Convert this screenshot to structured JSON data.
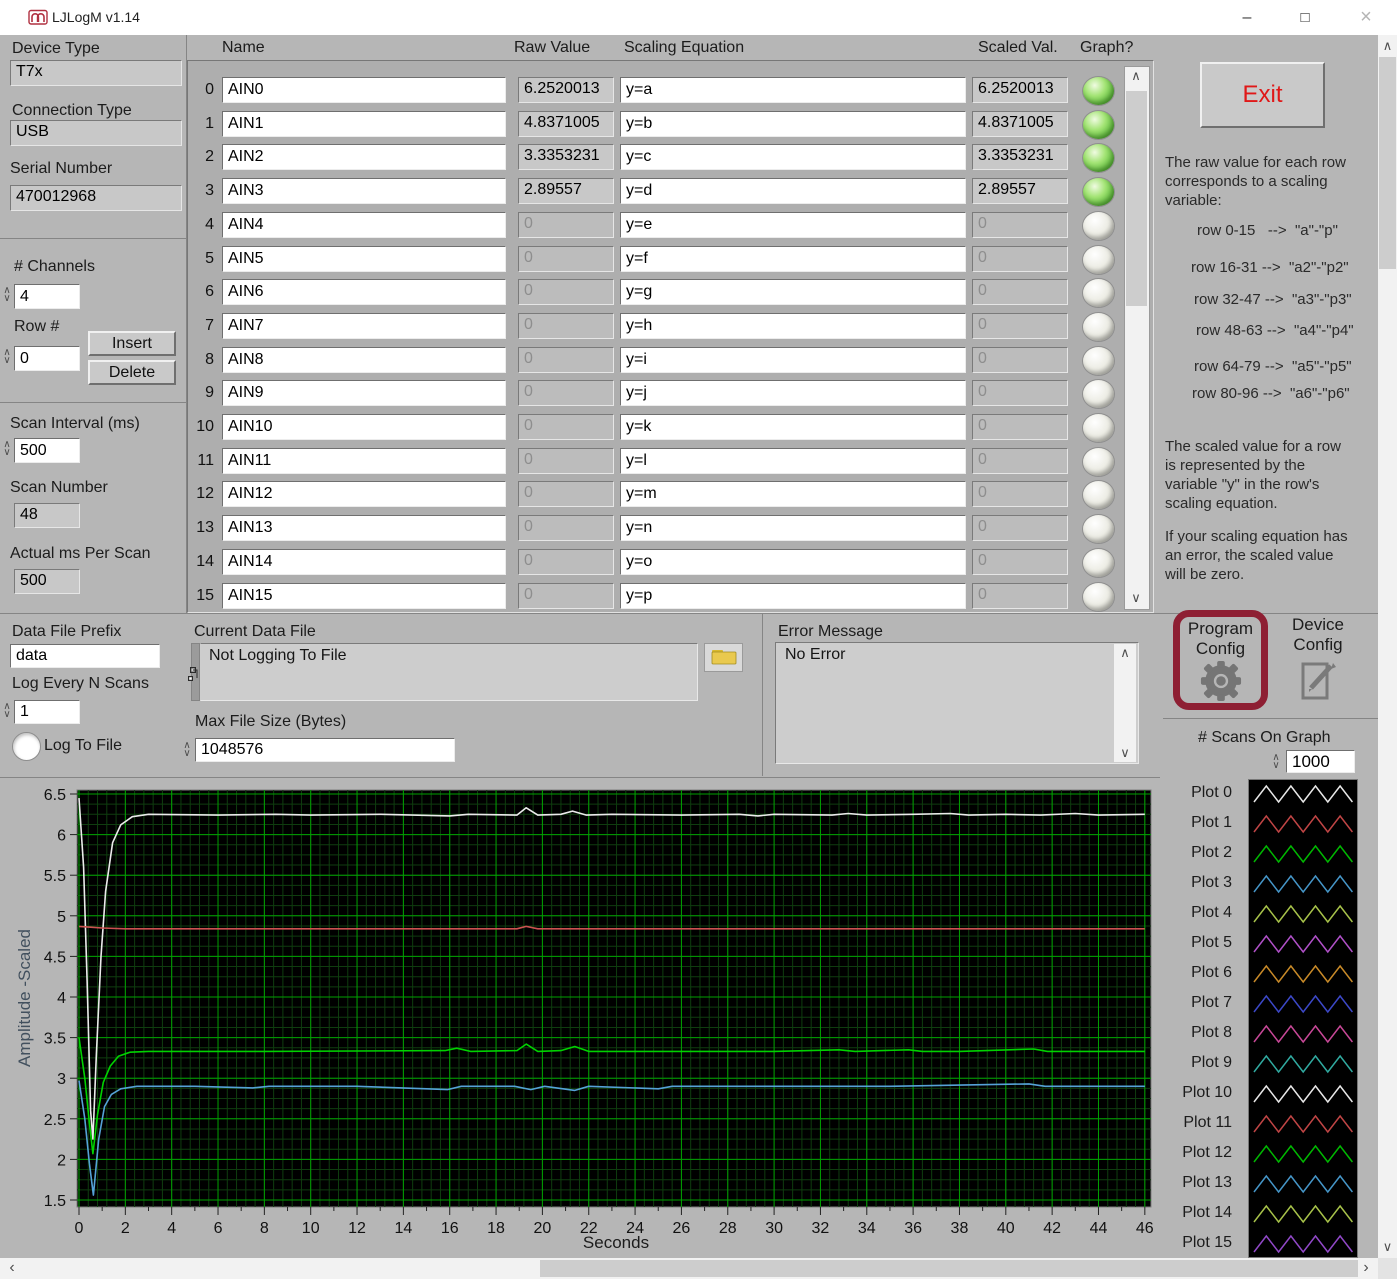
{
  "title_bar": {
    "title": "LJLogM v1.14",
    "minimize": "–",
    "maximize": "□",
    "close": "×"
  },
  "left_panel": {
    "device_type_label": "Device Type",
    "device_type": "T7x",
    "connection_type_label": "Connection Type",
    "connection_type": "USB",
    "serial_number_label": "Serial Number",
    "serial_number": "470012968",
    "channels_label": "# Channels",
    "channels": "4",
    "row_label": "Row #",
    "row": "0",
    "insert_label": "Insert",
    "delete_label": "Delete",
    "scan_interval_label": "Scan Interval (ms)",
    "scan_interval": "500",
    "scan_number_label": "Scan Number",
    "scan_number": "48",
    "actual_ms_label": "Actual ms Per Scan",
    "actual_ms": "500"
  },
  "table": {
    "headers": {
      "name": "Name",
      "raw": "Raw Value",
      "equation": "Scaling Equation",
      "scaled": "Scaled Val.",
      "graph": "Graph?"
    },
    "rows": [
      {
        "index": "0",
        "name": "AIN0",
        "raw": "6.2520013",
        "equation": "y=a",
        "scaled": "6.2520013",
        "graph_on": true
      },
      {
        "index": "1",
        "name": "AIN1",
        "raw": "4.8371005",
        "equation": "y=b",
        "scaled": "4.8371005",
        "graph_on": true
      },
      {
        "index": "2",
        "name": "AIN2",
        "raw": "3.3353231",
        "equation": "y=c",
        "scaled": "3.3353231",
        "graph_on": true
      },
      {
        "index": "3",
        "name": "AIN3",
        "raw": "2.89557",
        "equation": "y=d",
        "scaled": "2.89557",
        "graph_on": true
      },
      {
        "index": "4",
        "name": "AIN4",
        "raw": "0",
        "equation": "y=e",
        "scaled": "0",
        "graph_on": false
      },
      {
        "index": "5",
        "name": "AIN5",
        "raw": "0",
        "equation": "y=f",
        "scaled": "0",
        "graph_on": false
      },
      {
        "index": "6",
        "name": "AIN6",
        "raw": "0",
        "equation": "y=g",
        "scaled": "0",
        "graph_on": false
      },
      {
        "index": "7",
        "name": "AIN7",
        "raw": "0",
        "equation": "y=h",
        "scaled": "0",
        "graph_on": false
      },
      {
        "index": "8",
        "name": "AIN8",
        "raw": "0",
        "equation": "y=i",
        "scaled": "0",
        "graph_on": false
      },
      {
        "index": "9",
        "name": "AIN9",
        "raw": "0",
        "equation": "y=j",
        "scaled": "0",
        "graph_on": false
      },
      {
        "index": "10",
        "name": "AIN10",
        "raw": "0",
        "equation": "y=k",
        "scaled": "0",
        "graph_on": false
      },
      {
        "index": "11",
        "name": "AIN11",
        "raw": "0",
        "equation": "y=l",
        "scaled": "0",
        "graph_on": false
      },
      {
        "index": "12",
        "name": "AIN12",
        "raw": "0",
        "equation": "y=m",
        "scaled": "0",
        "graph_on": false
      },
      {
        "index": "13",
        "name": "AIN13",
        "raw": "0",
        "equation": "y=n",
        "scaled": "0",
        "graph_on": false
      },
      {
        "index": "14",
        "name": "AIN14",
        "raw": "0",
        "equation": "y=o",
        "scaled": "0",
        "graph_on": false
      },
      {
        "index": "15",
        "name": "AIN15",
        "raw": "0",
        "equation": "y=p",
        "scaled": "0",
        "graph_on": false
      }
    ]
  },
  "right_panel": {
    "exit_label": "Exit",
    "info1": "The raw value for each row\ncorresponds to a scaling\nvariable:",
    "mappings": [
      "row 0-15   -->  \"a\"-\"p\"",
      "row 16-31 -->  \"a2\"-\"p2\"",
      "row 32-47 -->  \"a3\"-\"p3\"",
      "row 48-63 -->  \"a4\"-\"p4\"",
      "row 64-79 -->  \"a5\"-\"p5\"",
      "row 80-96 -->  \"a6\"-\"p6\""
    ],
    "info2": "The scaled value for a row\nis represented by the\nvariable  \"y\" in the row's\nscaling equation.",
    "info3": "If your scaling  equation has\nan error, the scaled value\nwill be zero.",
    "program_config_label": "Program\nConfig",
    "device_config_label": "Device\nConfig",
    "scans_on_graph_label": "# Scans On Graph",
    "scans_on_graph": "1000"
  },
  "logging": {
    "data_file_prefix_label": "Data File Prefix",
    "data_file_prefix": "data",
    "log_every_label": "Log Every N Scans",
    "log_every": "1",
    "log_to_file_label": "Log To File",
    "current_data_file_label": "Current Data File",
    "current_data_file": "Not Logging To File",
    "max_file_size_label": "Max File Size (Bytes)",
    "max_file_size": "1048576"
  },
  "error_panel": {
    "label": "Error Message",
    "message": "No Error"
  },
  "colors": {
    "exit_text": "#e01818",
    "program_config_border": "#8e1f33",
    "led_on": "#5fbc3c",
    "led_off": "#e2e2da",
    "folder": "#e9c94e"
  },
  "chart_data": {
    "type": "line",
    "title": "",
    "xlabel": "Seconds",
    "ylabel": "Amplitude -Scaled",
    "xlim": [
      0,
      46
    ],
    "xtick_step": 2,
    "ylim": [
      1.5,
      6.5
    ],
    "ytick_step": 0.5,
    "x_minor": 0.4,
    "y_minor": 0.125,
    "grid": "on",
    "bg": "#000000",
    "major_grid": "#00a000",
    "minor_grid": "#0f3d0f",
    "series": [
      {
        "name": "AIN0 (Plot 0)",
        "color": "#ebebeb",
        "points": [
          [
            0,
            6.45
          ],
          [
            0.2,
            5.6
          ],
          [
            0.35,
            4.2
          ],
          [
            0.5,
            2.6
          ],
          [
            0.6,
            2.25
          ],
          [
            0.75,
            3.3
          ],
          [
            0.95,
            4.5
          ],
          [
            1.15,
            5.3
          ],
          [
            1.45,
            5.9
          ],
          [
            1.8,
            6.12
          ],
          [
            2.3,
            6.22
          ],
          [
            3,
            6.25
          ],
          [
            6,
            6.24
          ],
          [
            8.5,
            6.25
          ],
          [
            10,
            6.24
          ],
          [
            13,
            6.25
          ],
          [
            16,
            6.23
          ],
          [
            16.8,
            6.25
          ],
          [
            18.9,
            6.24
          ],
          [
            19.3,
            6.33
          ],
          [
            19.8,
            6.24
          ],
          [
            20.8,
            6.25
          ],
          [
            21.3,
            6.29
          ],
          [
            21.9,
            6.24
          ],
          [
            23,
            6.25
          ],
          [
            26,
            6.24
          ],
          [
            28.5,
            6.25
          ],
          [
            29.3,
            6.23
          ],
          [
            30,
            6.25
          ],
          [
            32.5,
            6.24
          ],
          [
            33.2,
            6.26
          ],
          [
            34,
            6.24
          ],
          [
            36,
            6.25
          ],
          [
            37.6,
            6.26
          ],
          [
            38.4,
            6.24
          ],
          [
            40,
            6.25
          ],
          [
            41.5,
            6.24
          ],
          [
            43,
            6.26
          ],
          [
            44,
            6.24
          ],
          [
            46,
            6.25
          ]
        ]
      },
      {
        "name": "AIN1 (Plot 1)",
        "color": "#cc5252",
        "points": [
          [
            0,
            4.87
          ],
          [
            0.5,
            4.86
          ],
          [
            1,
            4.85
          ],
          [
            2,
            4.84
          ],
          [
            6,
            4.84
          ],
          [
            18.9,
            4.84
          ],
          [
            19.3,
            4.87
          ],
          [
            19.8,
            4.84
          ],
          [
            30,
            4.84
          ],
          [
            46,
            4.84
          ]
        ]
      },
      {
        "name": "AIN2 (Plot 2)",
        "color": "#00d200",
        "points": [
          [
            0,
            3.5
          ],
          [
            0.25,
            3.0
          ],
          [
            0.45,
            2.45
          ],
          [
            0.6,
            2.07
          ],
          [
            0.8,
            2.55
          ],
          [
            1.05,
            2.95
          ],
          [
            1.35,
            3.15
          ],
          [
            1.7,
            3.27
          ],
          [
            2.2,
            3.32
          ],
          [
            3,
            3.33
          ],
          [
            8,
            3.33
          ],
          [
            15.8,
            3.34
          ],
          [
            16.3,
            3.37
          ],
          [
            16.9,
            3.33
          ],
          [
            18.9,
            3.34
          ],
          [
            19.3,
            3.42
          ],
          [
            19.8,
            3.33
          ],
          [
            20.8,
            3.34
          ],
          [
            21.4,
            3.39
          ],
          [
            22,
            3.33
          ],
          [
            25,
            3.33
          ],
          [
            30,
            3.33
          ],
          [
            32.8,
            3.35
          ],
          [
            33.5,
            3.33
          ],
          [
            35.8,
            3.35
          ],
          [
            36.4,
            3.33
          ],
          [
            38,
            3.33
          ],
          [
            41.2,
            3.36
          ],
          [
            41.8,
            3.33
          ],
          [
            44,
            3.33
          ],
          [
            46,
            3.33
          ]
        ]
      },
      {
        "name": "AIN3 (Plot 3)",
        "color": "#55a2d7",
        "points": [
          [
            0,
            2.97
          ],
          [
            0.25,
            2.5
          ],
          [
            0.45,
            1.95
          ],
          [
            0.62,
            1.56
          ],
          [
            0.85,
            2.25
          ],
          [
            1.1,
            2.65
          ],
          [
            1.4,
            2.8
          ],
          [
            1.8,
            2.87
          ],
          [
            2.5,
            2.9
          ],
          [
            5,
            2.9
          ],
          [
            7.5,
            2.88
          ],
          [
            8.2,
            2.9
          ],
          [
            12,
            2.9
          ],
          [
            15.9,
            2.86
          ],
          [
            16.5,
            2.9
          ],
          [
            18.8,
            2.9
          ],
          [
            19.5,
            2.86
          ],
          [
            20.1,
            2.9
          ],
          [
            21.4,
            2.85
          ],
          [
            22,
            2.9
          ],
          [
            25,
            2.87
          ],
          [
            25.6,
            2.9
          ],
          [
            30,
            2.9
          ],
          [
            35,
            2.9
          ],
          [
            41,
            2.93
          ],
          [
            41.7,
            2.9
          ],
          [
            44,
            2.9
          ],
          [
            46,
            2.9
          ]
        ]
      }
    ],
    "legend": {
      "position": "right",
      "entries": [
        {
          "label": "Plot 0",
          "color": "#e8e8e8"
        },
        {
          "label": "Plot 1",
          "color": "#c04545"
        },
        {
          "label": "Plot 2",
          "color": "#00b800"
        },
        {
          "label": "Plot 3",
          "color": "#4596c8"
        },
        {
          "label": "Plot 4",
          "color": "#a7c24a"
        },
        {
          "label": "Plot 5",
          "color": "#b050c8"
        },
        {
          "label": "Plot 6",
          "color": "#c88a28"
        },
        {
          "label": "Plot 7",
          "color": "#3c48c8"
        },
        {
          "label": "Plot 8",
          "color": "#c84898"
        },
        {
          "label": "Plot 9",
          "color": "#30aaa0"
        },
        {
          "label": "Plot 10",
          "color": "#e8e8e8"
        },
        {
          "label": "Plot 11",
          "color": "#c04545"
        },
        {
          "label": "Plot 12",
          "color": "#00b800"
        },
        {
          "label": "Plot 13",
          "color": "#4596c8"
        },
        {
          "label": "Plot 14",
          "color": "#a7c24a"
        },
        {
          "label": "Plot 15",
          "color": "#9148c8"
        }
      ]
    }
  }
}
